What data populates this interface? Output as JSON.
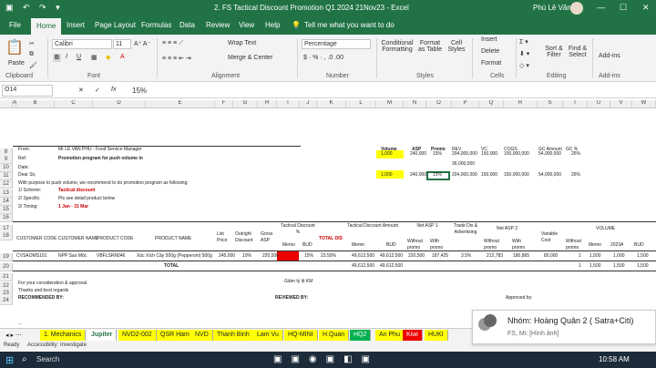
{
  "title": "2. FS Tactical Discount Promotion Q1.2024 21Nov23 - Excel",
  "user": "Phú Lê Văn",
  "tabs": [
    "File",
    "Home",
    "Insert",
    "Page Layout",
    "Formulas",
    "Data",
    "Review",
    "View",
    "Help",
    "Tell me what you want to do"
  ],
  "ribbon": {
    "clipboard": "Clipboard",
    "paste": "Paste",
    "font": "Font",
    "font_name": "Calibri",
    "font_size": "11",
    "alignment": "Alignment",
    "wrap": "Wrap Text",
    "merge": "Merge & Center",
    "number": "Number",
    "number_fmt": "Percentage",
    "cond": "Conditional Formatting",
    "fmt_table": "Format as Table",
    "cell_styles": "Cell Styles",
    "styles": "Styles",
    "insert": "Insert",
    "delete": "Delete",
    "format": "Format",
    "cells": "Cells",
    "sort": "Sort & Filter",
    "find": "Find & Select",
    "editing": "Editing",
    "addins": "Add-ins",
    "addins2": "Add-ins"
  },
  "formula": {
    "namebox": "O14",
    "fx": "fx",
    "value": "15%"
  },
  "columns": [
    "A",
    "B",
    "C",
    "D",
    "E",
    "F",
    "G",
    "H",
    "I",
    "J",
    "K",
    "L",
    "M",
    "N",
    "O",
    "P",
    "Q",
    "R",
    "S",
    "T",
    "U",
    "V",
    "W"
  ],
  "rows": [
    "8",
    "9",
    "10",
    "11",
    "12",
    "13",
    "14",
    "15",
    "16",
    "17",
    "18",
    "19",
    "20",
    "21",
    "22",
    "23",
    "24"
  ],
  "cells": {
    "from": "From:",
    "from_v": "Mr LE VAN PHU - Food Service Manager",
    "ref": "Ref:",
    "ref_v": "Promotion program for  push volume in",
    "date": "Date:",
    "dear": "Dear Sir,",
    "purpose": "With purpose to push volume,  we recommend to do promotion program as following:",
    "scheme": "1/ Scheme:",
    "scheme_v": "Tactical discount",
    "specific": "2/ Specific:",
    "specific_v": "Pls see detail product below",
    "timing": "3/ Timing:",
    "timing_v": "1 Jan  - 31 Mar",
    "hdr_volume": "Volume",
    "hdr_asp": "ASP",
    "hdr_promo": "Promo",
    "hdr_rev": "REV",
    "hdr_vc": "VC",
    "hdr_cogs": "COGS",
    "hdr_gc": "GC Amount",
    "hdr_gcp": "GC %",
    "r12": [
      "1,000",
      "240,000",
      "15%",
      "204,000,000",
      "150,000",
      "150,000,000",
      "54,000,000",
      "26%"
    ],
    "r13_rev": "36,000,000",
    "r14": [
      "1,000",
      "240,000",
      "15%",
      "204,000,000",
      "150,000",
      "150,000,000",
      "54,000,000",
      "26%"
    ],
    "th_customer_code": "CUSTOMER CODE",
    "th_customer_name": "CUSTOMER NAME",
    "th_product_code": "PRODUCT CODE",
    "th_product_name": "PRODUCT NAME",
    "th_list": "List Price",
    "th_outright": "Outright Discount",
    "th_gross": "Gross ASP",
    "th_tactical": "Tactical Discount %",
    "th_memo": "Memo",
    "th_bud": "BUD",
    "th_total_dis": "TOTAL DIS",
    "th_tac_amt": "Tactical Discount Amount",
    "th_memo2": "Memo",
    "th_bud2": "BUD",
    "th_net1": "Net ASP 1",
    "th_without": "Without promo",
    "th_with": "With promo",
    "th_trade": "Trade Dis & Advertising",
    "th_net2": "Net ASP 2",
    "th_without2": "Without promo",
    "th_with2": "With promo",
    "th_variable": "Variable Cost",
    "th_volume": "VOLUME",
    "th_without3": "Without promo",
    "th_memo3": "Memo",
    "th_2023": "2023A",
    "th_bud3": "BUD",
    "r19": [
      "CVSAOMS101",
      "NPP Sao Mộc",
      "VBFLSRN046",
      "Xúc Xích Cây 500g (Pepperoni) 500g",
      "245,000",
      "10%",
      "220,500",
      "",
      "15%",
      "23.50%",
      "49,612,500",
      "49,612,500",
      "220,500",
      "187,425",
      "3.5%",
      "212,783",
      "180,865",
      "80,000",
      "1",
      "1,500",
      "1,000",
      "1,500"
    ],
    "total": "TOTAL",
    "r20_l": "49,612,500",
    "r20_m": "49,612,500",
    "r20_u": "1",
    "r20_v": "1,500",
    "r20_w": "1,500",
    "r20_x": "1,500",
    "consider": "For your consideration & approval.",
    "gtkm": "Giảm tỷ lệ KM",
    "thanks": "Thanks and best regards",
    "recommended": "RECOMMENDED BY:",
    "reviewed": "REVIEWED BY:",
    "approved": "Approved by:"
  },
  "sheets": [
    "1. Mechanics",
    "Jupiter",
    "NVD2-002",
    "QSR Ham",
    "NVD",
    "Thanh Binh",
    "Lam Vu",
    "HQ-MINI",
    "H.Quan",
    "HQ2",
    "An Phu",
    "Kiwi",
    "HUKI"
  ],
  "status": {
    "ready": "Ready",
    "accessibility": "Accessibility: Investigate"
  },
  "toast": {
    "title": "Nhóm: Hoàng Quân 2 ( Satra+Citi)",
    "msg": "FS, Mi: [Hình ảnh]"
  },
  "taskbar": {
    "search": "Search",
    "time": "10:58 AM"
  },
  "colors": {
    "excel_green": "#217346",
    "highlight": "#ffff00",
    "red": "#e00000"
  }
}
